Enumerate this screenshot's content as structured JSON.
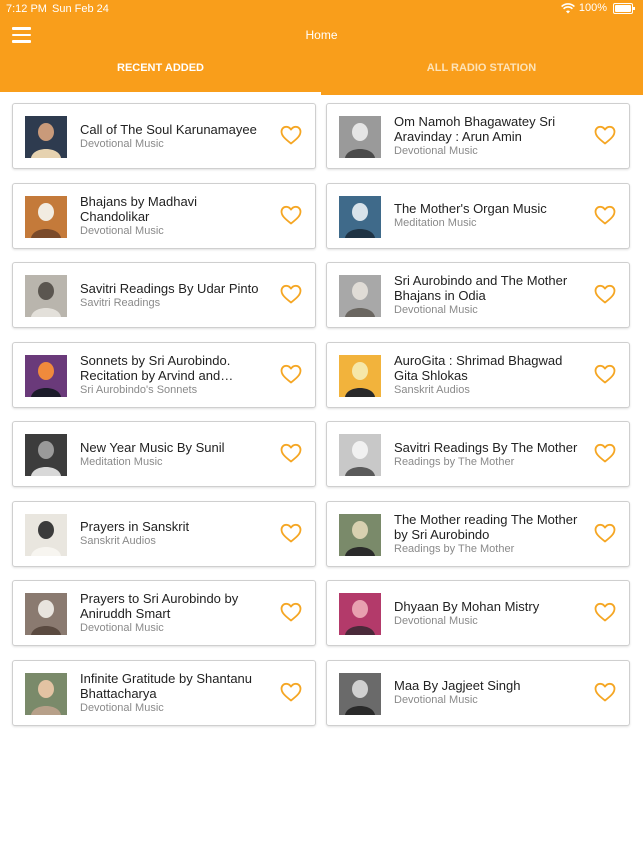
{
  "status_bar": {
    "time": "7:12 PM",
    "date": "Sun Feb 24",
    "battery": "100%"
  },
  "header": {
    "title": "Home",
    "menu_icon": "hamburger-menu-icon"
  },
  "tabs": [
    {
      "label": "RECENT ADDED",
      "active": true
    },
    {
      "label": "ALL RADIO STATION",
      "active": false
    }
  ],
  "colors": {
    "accent": "#f99e1b",
    "heart": "#f5a623"
  },
  "left_items": [
    {
      "title": "Call of The Soul Karunamayee",
      "subtitle": "Devotional Music"
    },
    {
      "title": "Bhajans by Madhavi Chandolikar",
      "subtitle": "Devotional Music"
    },
    {
      "title": "Savitri Readings By Udar Pinto",
      "subtitle": "Savitri Readings"
    },
    {
      "title": "Sonnets by Sri Aurobindo. Recitation by Arvind and Jasmine",
      "subtitle": "Sri Aurobindo's Sonnets"
    },
    {
      "title": "New Year Music By Sunil",
      "subtitle": "Meditation Music"
    },
    {
      "title": "Prayers in Sanskrit",
      "subtitle": "Sanskrit Audios"
    },
    {
      "title": "Prayers to Sri Aurobindo by Aniruddh Smart",
      "subtitle": "Devotional Music"
    },
    {
      "title": "Infinite Gratitude by Shantanu Bhattacharya",
      "subtitle": "Devotional Music"
    }
  ],
  "right_items": [
    {
      "title": "Om Namoh Bhagawatey Sri Aravinday : Arun Amin",
      "subtitle": "Devotional Music"
    },
    {
      "title": "The Mother's Organ Music",
      "subtitle": "Meditation Music"
    },
    {
      "title": "Sri Aurobindo and The Mother Bhajans in Odia",
      "subtitle": "Devotional Music"
    },
    {
      "title": "AuroGita : Shrimad Bhagwad Gita Shlokas",
      "subtitle": "Sanskrit Audios"
    },
    {
      "title": "Savitri Readings By The Mother",
      "subtitle": "Readings by The Mother"
    },
    {
      "title": "The Mother reading The Mother by Sri Aurobindo",
      "subtitle": "Readings by The Mother"
    },
    {
      "title": "Dhyaan By Mohan Mistry",
      "subtitle": "Devotional Music"
    },
    {
      "title": "Maa By Jagjeet Singh",
      "subtitle": "Devotional Music"
    }
  ]
}
